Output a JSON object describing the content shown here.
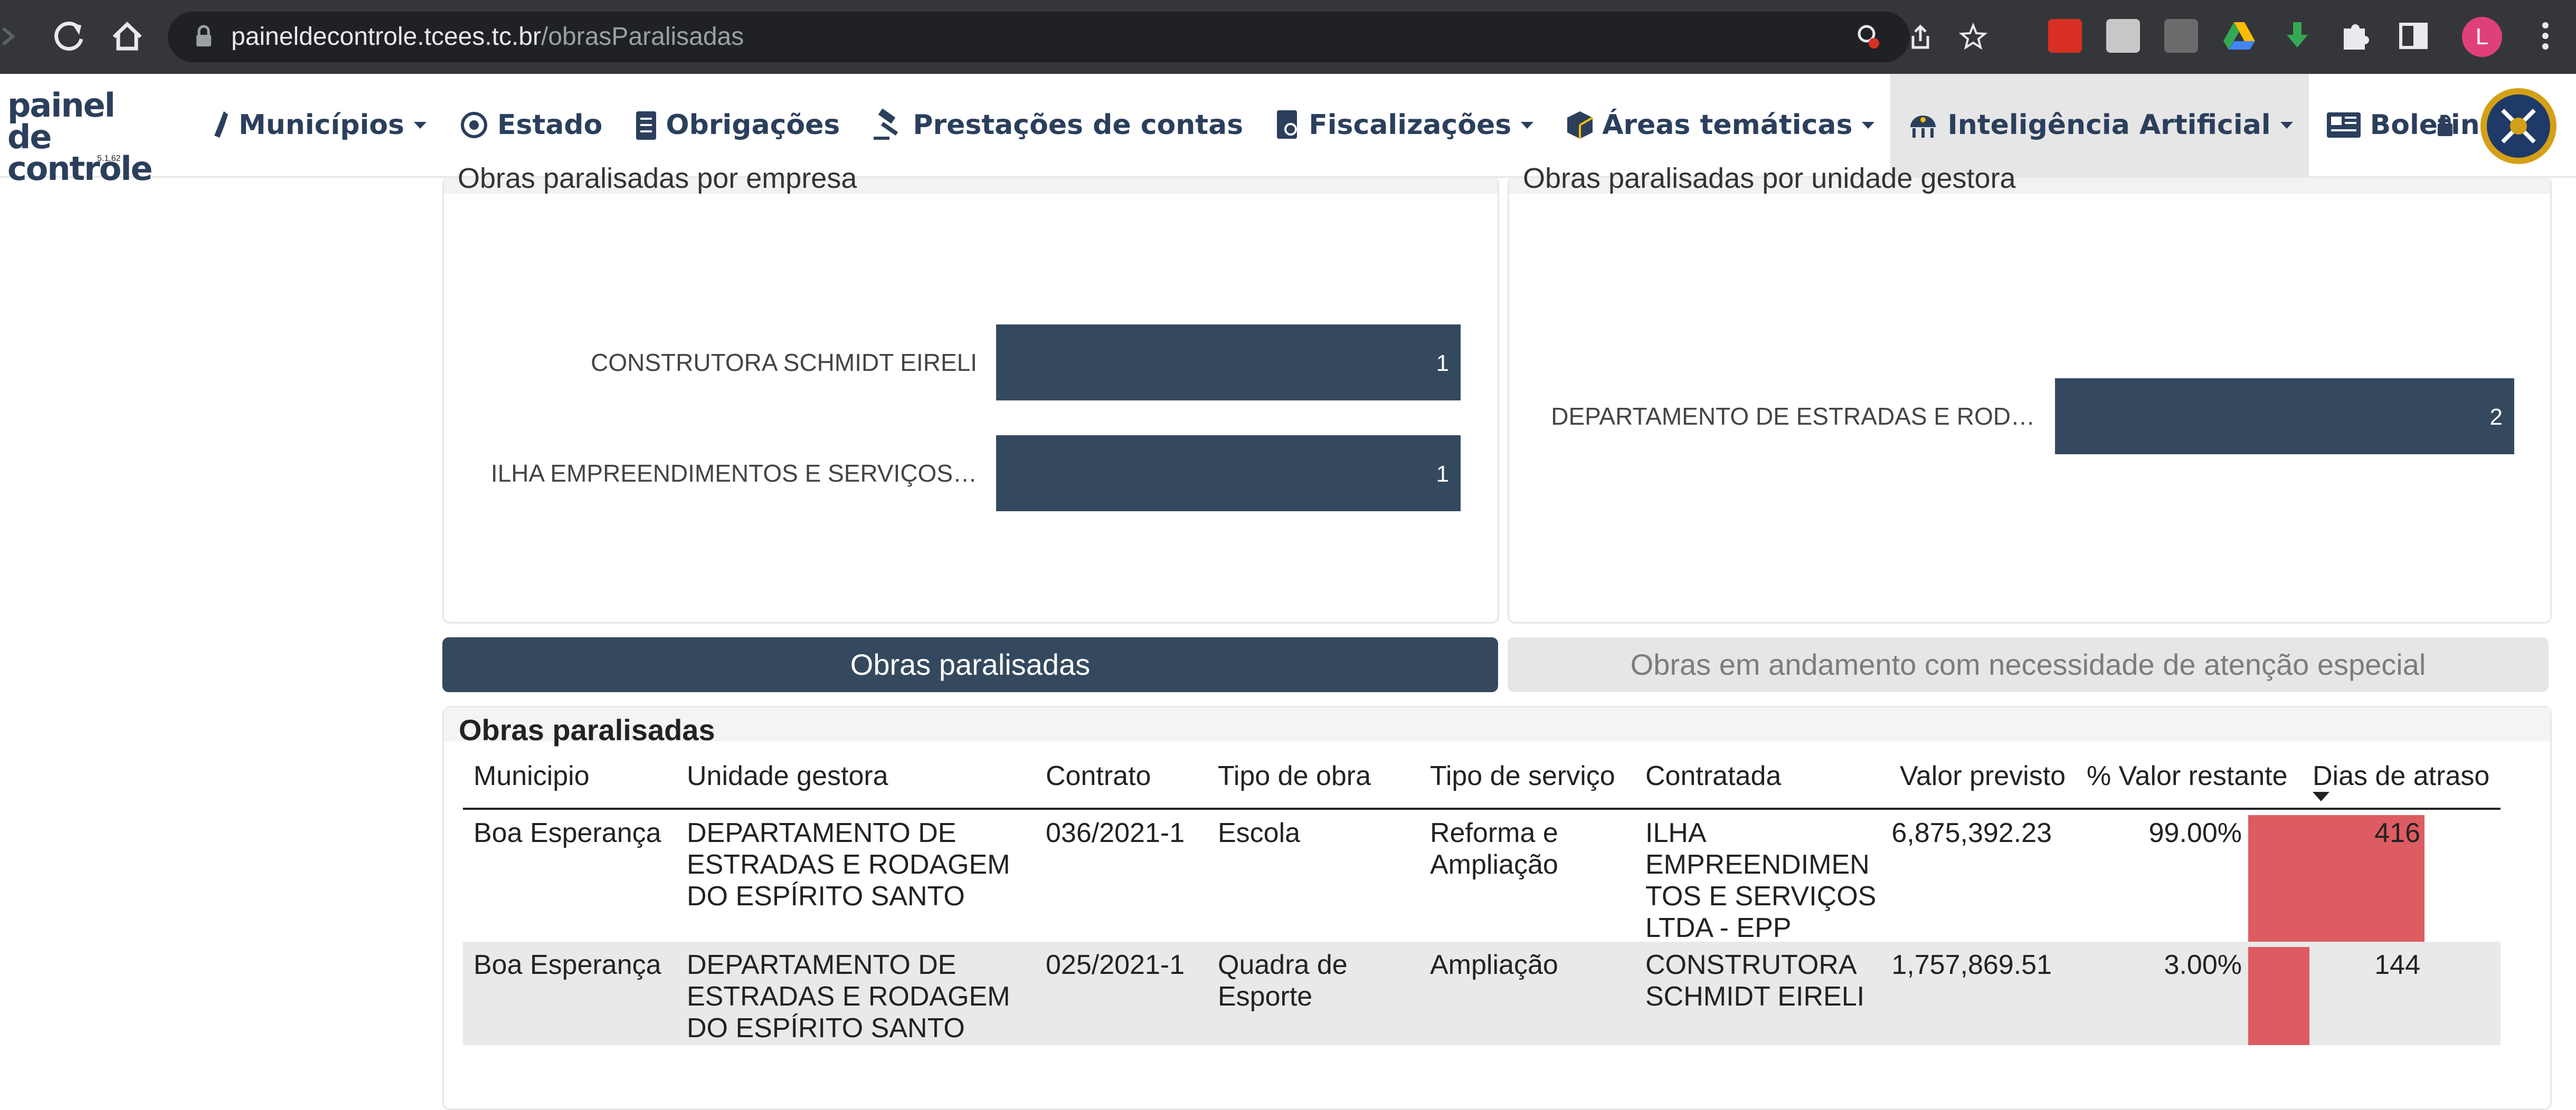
{
  "browser": {
    "url_domain": "paineldecontrole.tcees.tc.br",
    "url_path": "/obrasParalisadas",
    "profile_initial": "L"
  },
  "app": {
    "brand_line1": "painel de",
    "brand_line2": "controle",
    "version": "5.1.62",
    "menu": [
      {
        "label": "Municípios",
        "icon": "municipio-icon",
        "dropdown": true
      },
      {
        "label": "Estado",
        "icon": "estado-icon",
        "dropdown": false
      },
      {
        "label": "Obrigações",
        "icon": "checklist-icon",
        "dropdown": false
      },
      {
        "label": "Prestações de contas",
        "icon": "gavel-icon",
        "dropdown": false
      },
      {
        "label": "Fiscalizações",
        "icon": "document-search-icon",
        "dropdown": true
      },
      {
        "label": "Áreas temáticas",
        "icon": "cube-icon",
        "dropdown": true
      },
      {
        "label": "Inteligência Artificial",
        "icon": "robot-icon",
        "dropdown": true
      },
      {
        "label": "Boletins",
        "icon": "newspaper-icon",
        "dropdown": false
      }
    ]
  },
  "panels": {
    "by_company_title": "Obras paralisadas por empresa",
    "by_unit_title": "Obras paralisadas por unidade gestora"
  },
  "chart_data": [
    {
      "type": "bar",
      "orientation": "horizontal",
      "title": "Obras paralisadas por empresa",
      "categories": [
        "CONSTRUTORA SCHMIDT EIRELI",
        "ILHA EMPREENDIMENTOS E SERVIÇOS…"
      ],
      "values": [
        1,
        1
      ],
      "color": "#34495e"
    },
    {
      "type": "bar",
      "orientation": "horizontal",
      "title": "Obras paralisadas por unidade gestora",
      "categories": [
        "DEPARTAMENTO DE ESTRADAS E ROD…"
      ],
      "values": [
        2
      ],
      "color": "#34495e"
    }
  ],
  "tabs": [
    {
      "label": "Obras paralisadas",
      "active": true
    },
    {
      "label": "Obras em andamento com necessidade de atenção especial",
      "active": false
    }
  ],
  "table": {
    "title": "Obras paralisadas",
    "columns": [
      "Municipio",
      "Unidade gestora",
      "Contrato",
      "Tipo de obra",
      "Tipo de serviço",
      "Contratada",
      "Valor previsto",
      "% Valor restante",
      "Dias de atraso"
    ],
    "sorted_column": "Dias de atraso",
    "max_delay": 416,
    "rows": [
      {
        "municipio": "Boa Esperança",
        "unidade": [
          "DEPARTAMENTO DE",
          "ESTRADAS E RODAGEM",
          "DO ESPÍRITO SANTO"
        ],
        "contrato": "036/2021-1",
        "tipo_obra": [
          "Escola"
        ],
        "tipo_servico": [
          "Reforma e",
          "Ampliação"
        ],
        "contratada": [
          "ILHA",
          "EMPREENDIMEN",
          "TOS E SERVIÇOS",
          "LTDA - EPP"
        ],
        "valor_previsto": "6,875,392.23",
        "valor_restante": "99.00%",
        "dias_atraso": 416
      },
      {
        "municipio": "Boa Esperança",
        "unidade": [
          "DEPARTAMENTO DE",
          "ESTRADAS E RODAGEM",
          "DO ESPÍRITO SANTO"
        ],
        "contrato": "025/2021-1",
        "tipo_obra": [
          "Quadra de",
          "Esporte"
        ],
        "tipo_servico": [
          "Ampliação"
        ],
        "contratada": [
          "CONSTRUTORA",
          "SCHMIDT EIRELI"
        ],
        "valor_previsto": "1,757,869.51",
        "valor_restante": "3.00%",
        "dias_atraso": 144
      }
    ],
    "delay_color": "#dd5c61"
  }
}
